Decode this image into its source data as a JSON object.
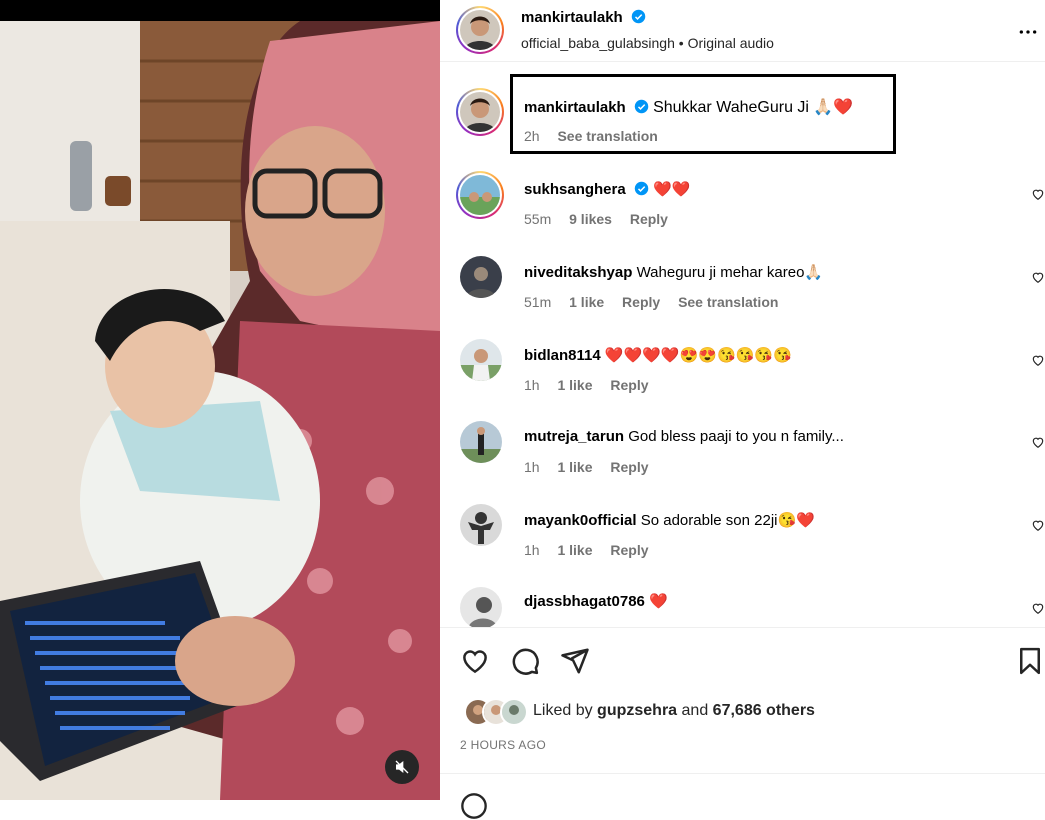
{
  "post": {
    "author": "mankirtaulakh",
    "audio_user": "official_baba_gulabsingh",
    "audio_separator": "•",
    "audio_label": "Original audio"
  },
  "caption": {
    "user": "mankirtaulakh",
    "text": "Shukkar WaheGuru Ji 🙏🏻❤️",
    "time": "2h",
    "translate": "See translation"
  },
  "comments": [
    {
      "user": "sukhsanghera",
      "verified": true,
      "text": "❤️❤️",
      "time": "55m",
      "likes": "9 likes",
      "reply": "Reply"
    },
    {
      "user": "niveditakshyap",
      "text": "Waheguru ji mehar kareo🙏🏻",
      "time": "51m",
      "likes": "1 like",
      "reply": "Reply",
      "translate": "See translation"
    },
    {
      "user": "bidlan8114",
      "text": "❤️❤️❤️❤️😍😍😘😘😘😘",
      "time": "1h",
      "likes": "1 like",
      "reply": "Reply"
    },
    {
      "user": "mutreja_tarun",
      "text": "God bless paaji to you n family...",
      "time": "1h",
      "likes": "1 like",
      "reply": "Reply"
    },
    {
      "user": "mayank0official",
      "text": "So adorable son 22ji😘❤️",
      "time": "1h",
      "likes": "1 like",
      "reply": "Reply"
    },
    {
      "user": "djassbhagat0786",
      "text": "❤️",
      "time": "",
      "likes": "",
      "reply": ""
    }
  ],
  "likes": {
    "prefix": "Liked by",
    "user": "gupzsehra",
    "middle": "and",
    "others": "67,686 others"
  },
  "timestamp": "2 HOURS AGO",
  "icons": [
    "verified-icon",
    "more-icon",
    "heart-icon",
    "comment-icon",
    "share-icon",
    "bookmark-icon",
    "mute-icon"
  ],
  "colors": {
    "verified": "#0095f6",
    "meta": "#737373",
    "text": "#000000"
  }
}
